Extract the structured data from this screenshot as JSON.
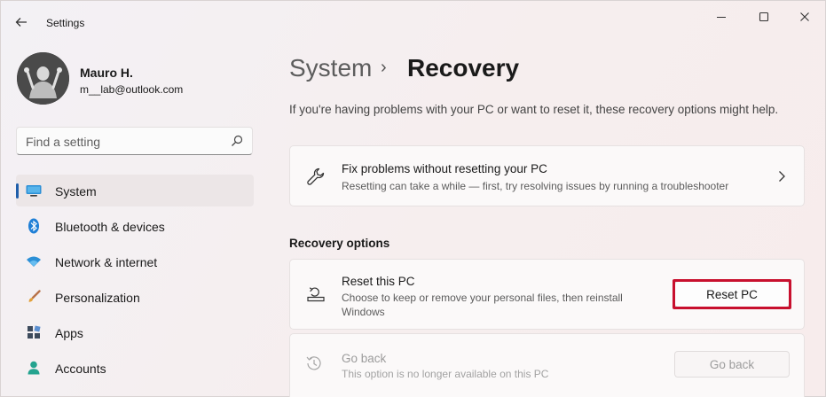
{
  "window": {
    "title": "Settings"
  },
  "profile": {
    "name": "Mauro H.",
    "email": "m__lab@outlook.com"
  },
  "search": {
    "placeholder": "Find a setting"
  },
  "sidebar": {
    "items": [
      {
        "label": "System",
        "icon": "system-display-icon",
        "active": true
      },
      {
        "label": "Bluetooth & devices",
        "icon": "bluetooth-icon",
        "active": false
      },
      {
        "label": "Network & internet",
        "icon": "wifi-icon",
        "active": false
      },
      {
        "label": "Personalization",
        "icon": "paintbrush-icon",
        "active": false
      },
      {
        "label": "Apps",
        "icon": "apps-icon",
        "active": false
      },
      {
        "label": "Accounts",
        "icon": "person-icon",
        "active": false
      }
    ]
  },
  "breadcrumb": {
    "parent": "System",
    "separator": "›",
    "current": "Recovery"
  },
  "main": {
    "intro": "If you're having problems with your PC or want to reset it, these recovery options might help.",
    "fix_card": {
      "title": "Fix problems without resetting your PC",
      "description": "Resetting can take a while — first, try resolving issues by running a troubleshooter"
    },
    "section_label": "Recovery options",
    "reset_card": {
      "title": "Reset this PC",
      "description": "Choose to keep or remove your personal files, then reinstall Windows",
      "button": "Reset PC"
    },
    "goback_card": {
      "title": "Go back",
      "description": "This option is no longer available on this PC",
      "button": "Go back"
    }
  },
  "colors": {
    "accent": "#1f5eaa",
    "highlight": "#c8102e"
  }
}
